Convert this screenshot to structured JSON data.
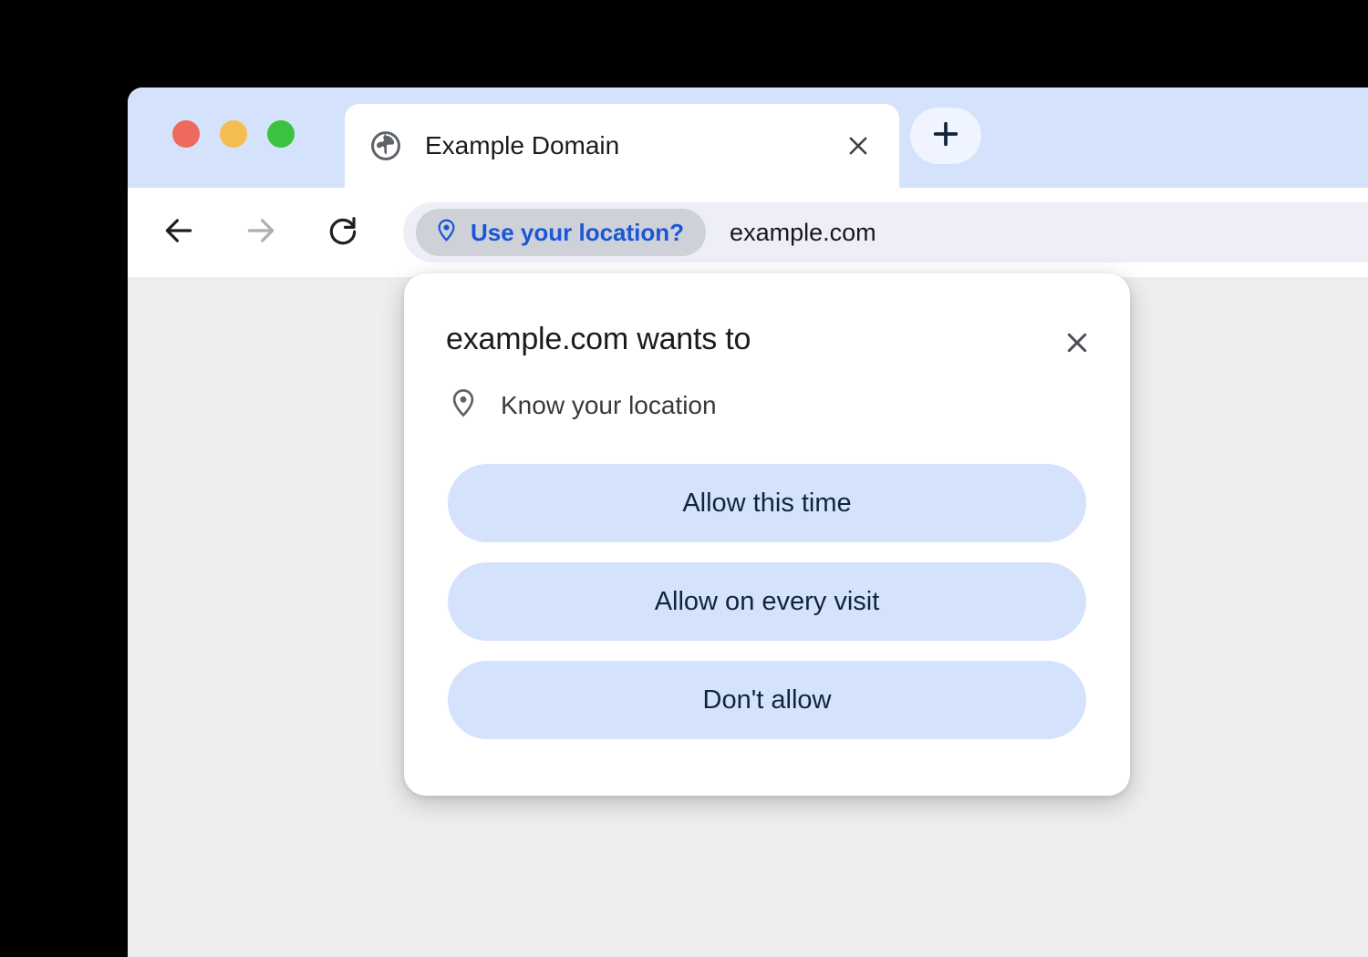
{
  "window": {
    "traffic_lights": [
      {
        "name": "close",
        "color": "#ee6a5f"
      },
      {
        "name": "minimize",
        "color": "#f5bd4f"
      },
      {
        "name": "zoom",
        "color": "#3ac33f"
      }
    ]
  },
  "tab_strip": {
    "background_color": "#d5e2fb",
    "active_tab": {
      "favicon": "globe-icon",
      "title": "Example Domain",
      "close_label": "×"
    },
    "new_tab_label": "+"
  },
  "toolbar": {
    "back_label": "←",
    "forward_label": "→",
    "reload_label": "↻",
    "omnibox": {
      "permission_chip": {
        "icon": "location-pin-icon",
        "label": "Use your location?",
        "text_color": "#1a56d6",
        "background_color": "#cfd1d8"
      },
      "url": "example.com",
      "background_color": "#edeef6"
    }
  },
  "page": {
    "background_color": "#eeeeee"
  },
  "dialog": {
    "title": "example.com wants to",
    "close_label": "×",
    "permission": {
      "icon": "location-pin-icon",
      "label": "Know your location"
    },
    "buttons": [
      {
        "label": "Allow this time",
        "name": "allow-this-time"
      },
      {
        "label": "Allow on every visit",
        "name": "allow-every-visit"
      },
      {
        "label": "Don't allow",
        "name": "dont-allow"
      }
    ],
    "button_background_color": "#d5e2fc",
    "button_text_color": "#10243e"
  }
}
